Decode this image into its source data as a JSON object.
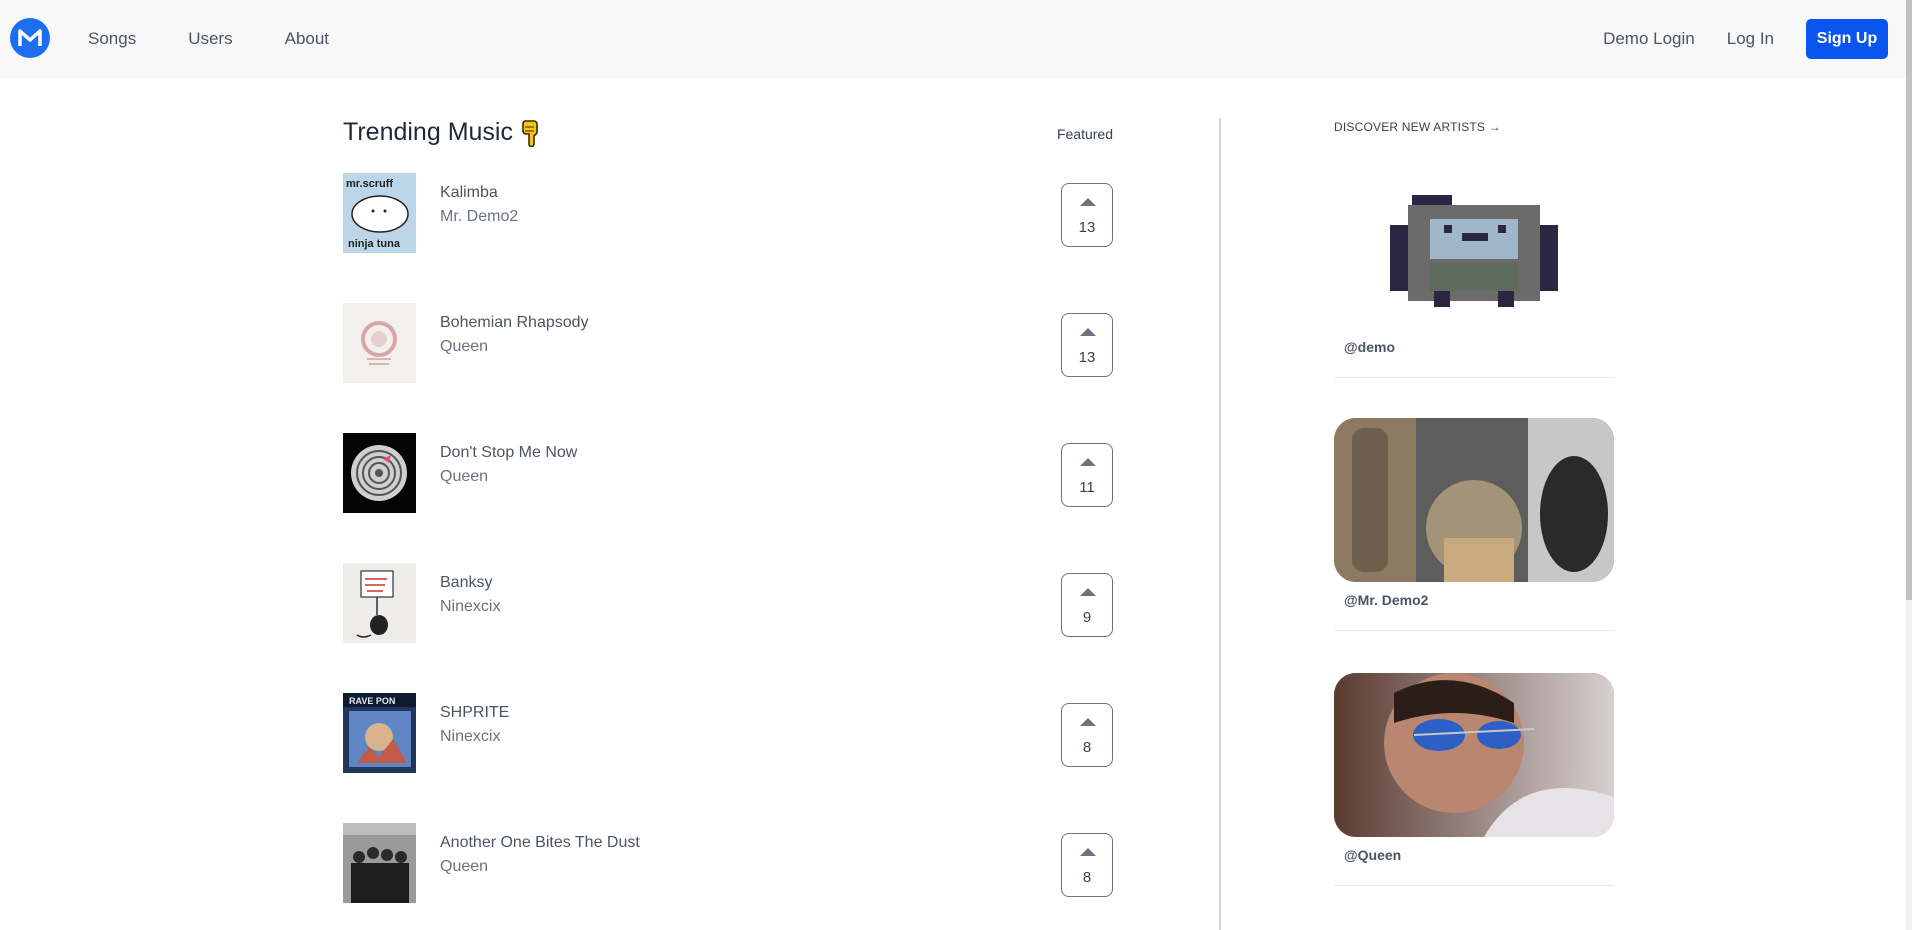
{
  "nav": {
    "logo_letter": "M",
    "links": [
      "Songs",
      "Users",
      "About"
    ],
    "demo_login": "Demo Login",
    "log_in": "Log In",
    "sign_up": "Sign Up"
  },
  "trending": {
    "title": "Trending Music",
    "featured_label": "Featured",
    "songs": [
      {
        "title": "Kalimba",
        "artist": "Mr. Demo2",
        "votes": "13"
      },
      {
        "title": "Bohemian Rhapsody",
        "artist": "Queen",
        "votes": "13"
      },
      {
        "title": "Don't Stop Me Now",
        "artist": "Queen",
        "votes": "11"
      },
      {
        "title": "Banksy",
        "artist": "Ninexcix",
        "votes": "9"
      },
      {
        "title": "SHPRITE",
        "artist": "Ninexcix",
        "votes": "8"
      },
      {
        "title": "Another One Bites The Dust",
        "artist": "Queen",
        "votes": "8"
      }
    ]
  },
  "sidebar": {
    "discover_label": "DISCOVER NEW ARTISTS →",
    "artists": [
      {
        "handle": "@demo"
      },
      {
        "handle": "@Mr. Demo2"
      },
      {
        "handle": "@Queen"
      }
    ]
  },
  "cover_texts": {
    "kalimba_top": "mr.scruff",
    "kalimba_bottom": "ninja tuna",
    "shprite_top": "RAVE PON"
  },
  "colors": {
    "accent": "#0a55f0",
    "logo": "#1d6ff2"
  }
}
